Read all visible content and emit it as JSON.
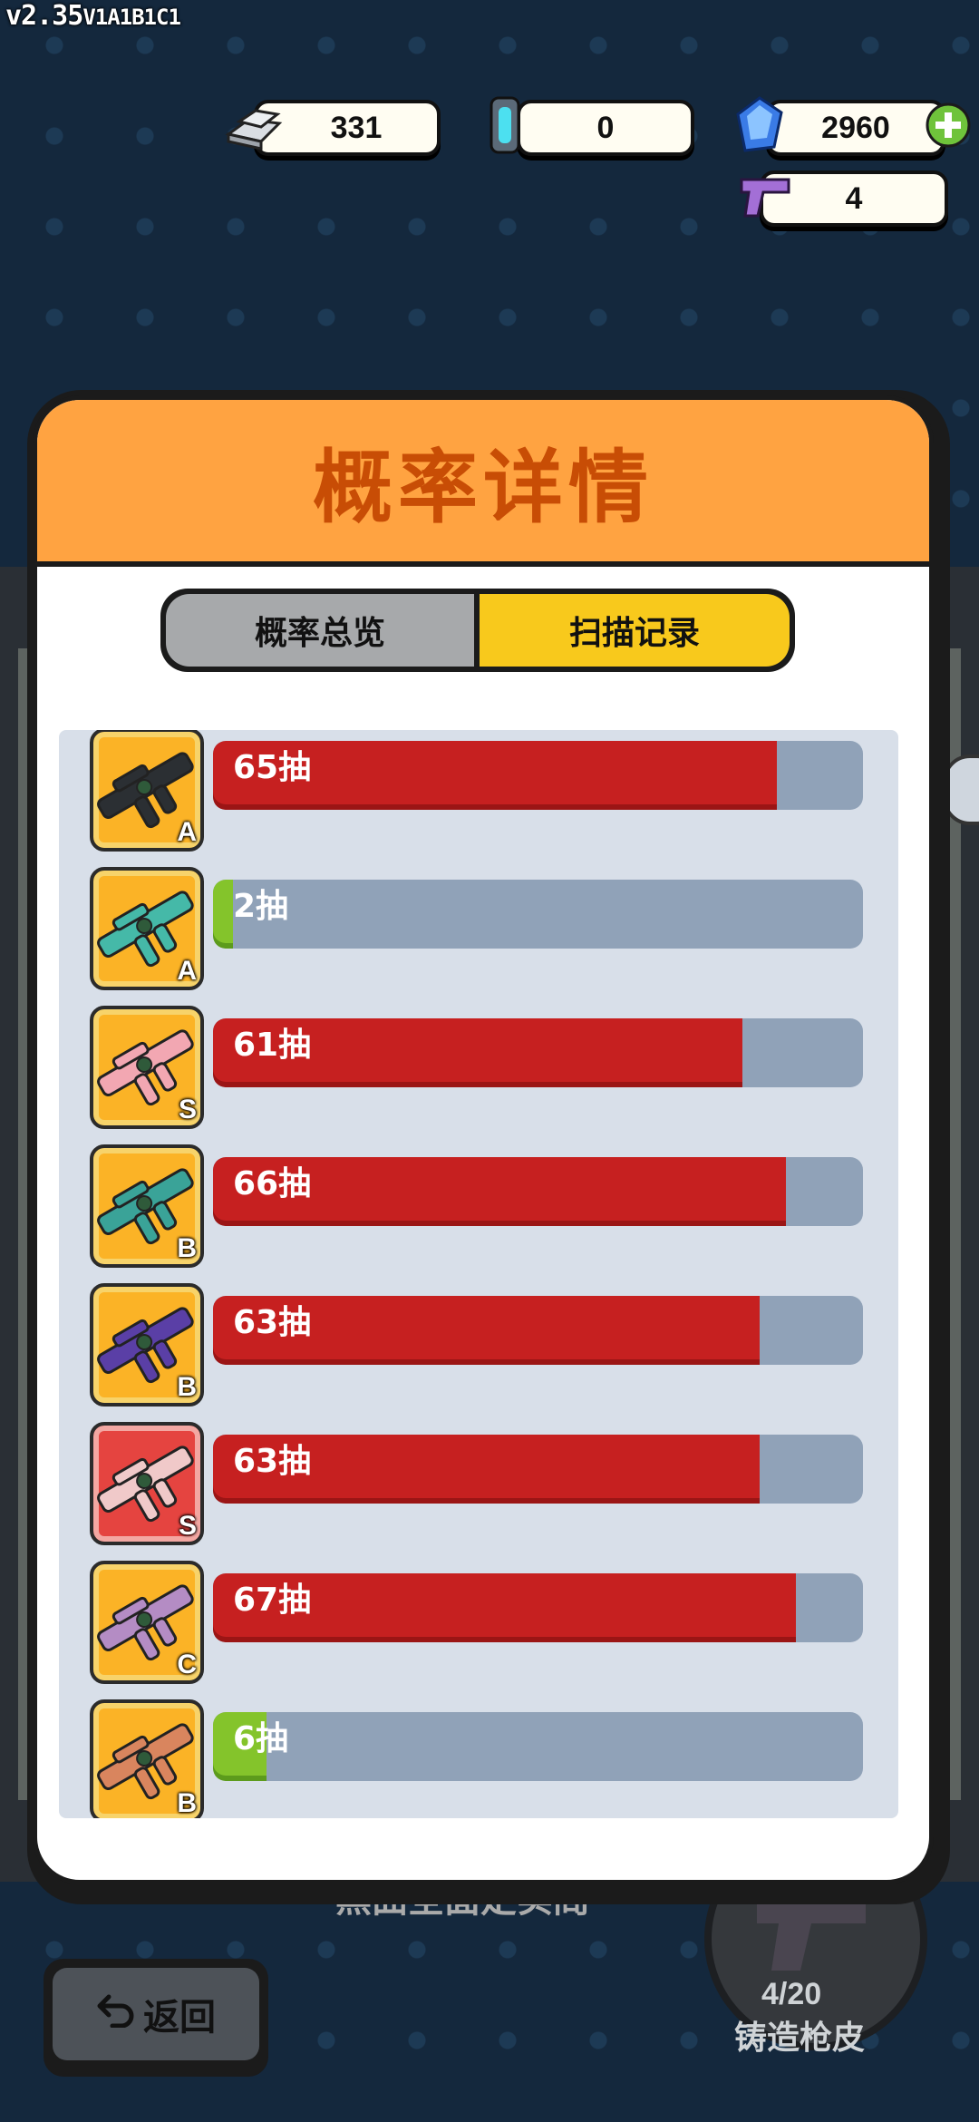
{
  "version": {
    "main": "v2.35",
    "sub": "V1A1B1C1"
  },
  "currencies": {
    "silver": "331",
    "capsule": "0",
    "diamond": "2960",
    "gun_ticket": "4"
  },
  "background": {
    "bottom_text": "黑曲全面定实阁",
    "forge_count": "4/20",
    "forge_label": "铸造枪皮"
  },
  "back_button": {
    "label": "返回"
  },
  "modal": {
    "title": "概率详情",
    "tabs": [
      "概率总览",
      "扫描记录"
    ],
    "active_tab": 1
  },
  "records": [
    {
      "grade": "A",
      "label": "65抽",
      "fraction": 0.868,
      "bar_color": "red",
      "skin_color": "#2b2f33",
      "thumb": "orange"
    },
    {
      "grade": "A",
      "label": "2抽",
      "fraction": 0.03,
      "bar_color": "green",
      "skin_color": "#45b9a8",
      "thumb": "orange"
    },
    {
      "grade": "S",
      "label": "61抽",
      "fraction": 0.814,
      "bar_color": "red",
      "skin_color": "#f2a7b2",
      "thumb": "orange"
    },
    {
      "grade": "B",
      "label": "66抽",
      "fraction": 0.882,
      "bar_color": "red",
      "skin_color": "#3aa398",
      "thumb": "orange"
    },
    {
      "grade": "B",
      "label": "63抽",
      "fraction": 0.841,
      "bar_color": "red",
      "skin_color": "#5a3fa6",
      "thumb": "orange"
    },
    {
      "grade": "S",
      "label": "63抽",
      "fraction": 0.841,
      "bar_color": "red",
      "skin_color": "#f0c9c9",
      "thumb": "red"
    },
    {
      "grade": "C",
      "label": "67抽",
      "fraction": 0.897,
      "bar_color": "red",
      "skin_color": "#b48cc4",
      "thumb": "orange"
    },
    {
      "grade": "B",
      "label": "6抽",
      "fraction": 0.082,
      "bar_color": "green",
      "skin_color": "#d9855e",
      "thumb": "orange"
    }
  ]
}
